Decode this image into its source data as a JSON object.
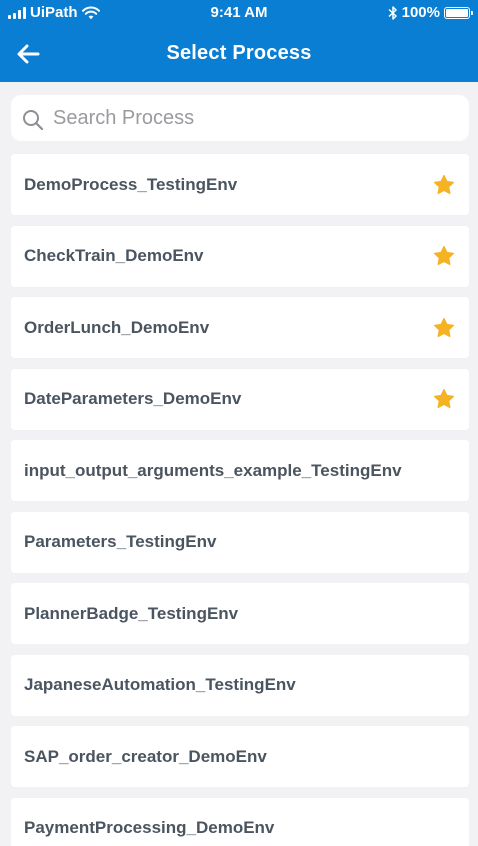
{
  "status_bar": {
    "carrier": "UiPath",
    "time": "9:41 AM",
    "battery": "100%"
  },
  "nav": {
    "title": "Select Process",
    "back_icon": "back-arrow-icon"
  },
  "search": {
    "placeholder": "Search Process",
    "value": "",
    "icon": "search-icon"
  },
  "colors": {
    "accent": "#0a7ed3",
    "star": "#f5b324",
    "text": "#4a5560"
  },
  "processes": [
    {
      "label": "DemoProcess_TestingEnv",
      "favorite": true
    },
    {
      "label": "CheckTrain_DemoEnv",
      "favorite": true
    },
    {
      "label": "OrderLunch_DemoEnv",
      "favorite": true
    },
    {
      "label": "DateParameters_DemoEnv",
      "favorite": true
    },
    {
      "label": "input_output_arguments_example_TestingEnv",
      "favorite": false
    },
    {
      "label": "Parameters_TestingEnv",
      "favorite": false
    },
    {
      "label": "PlannerBadge_TestingEnv",
      "favorite": false
    },
    {
      "label": "JapaneseAutomation_TestingEnv",
      "favorite": false
    },
    {
      "label": "SAP_order_creator_DemoEnv",
      "favorite": false
    },
    {
      "label": "PaymentProcessing_DemoEnv",
      "favorite": false
    }
  ]
}
